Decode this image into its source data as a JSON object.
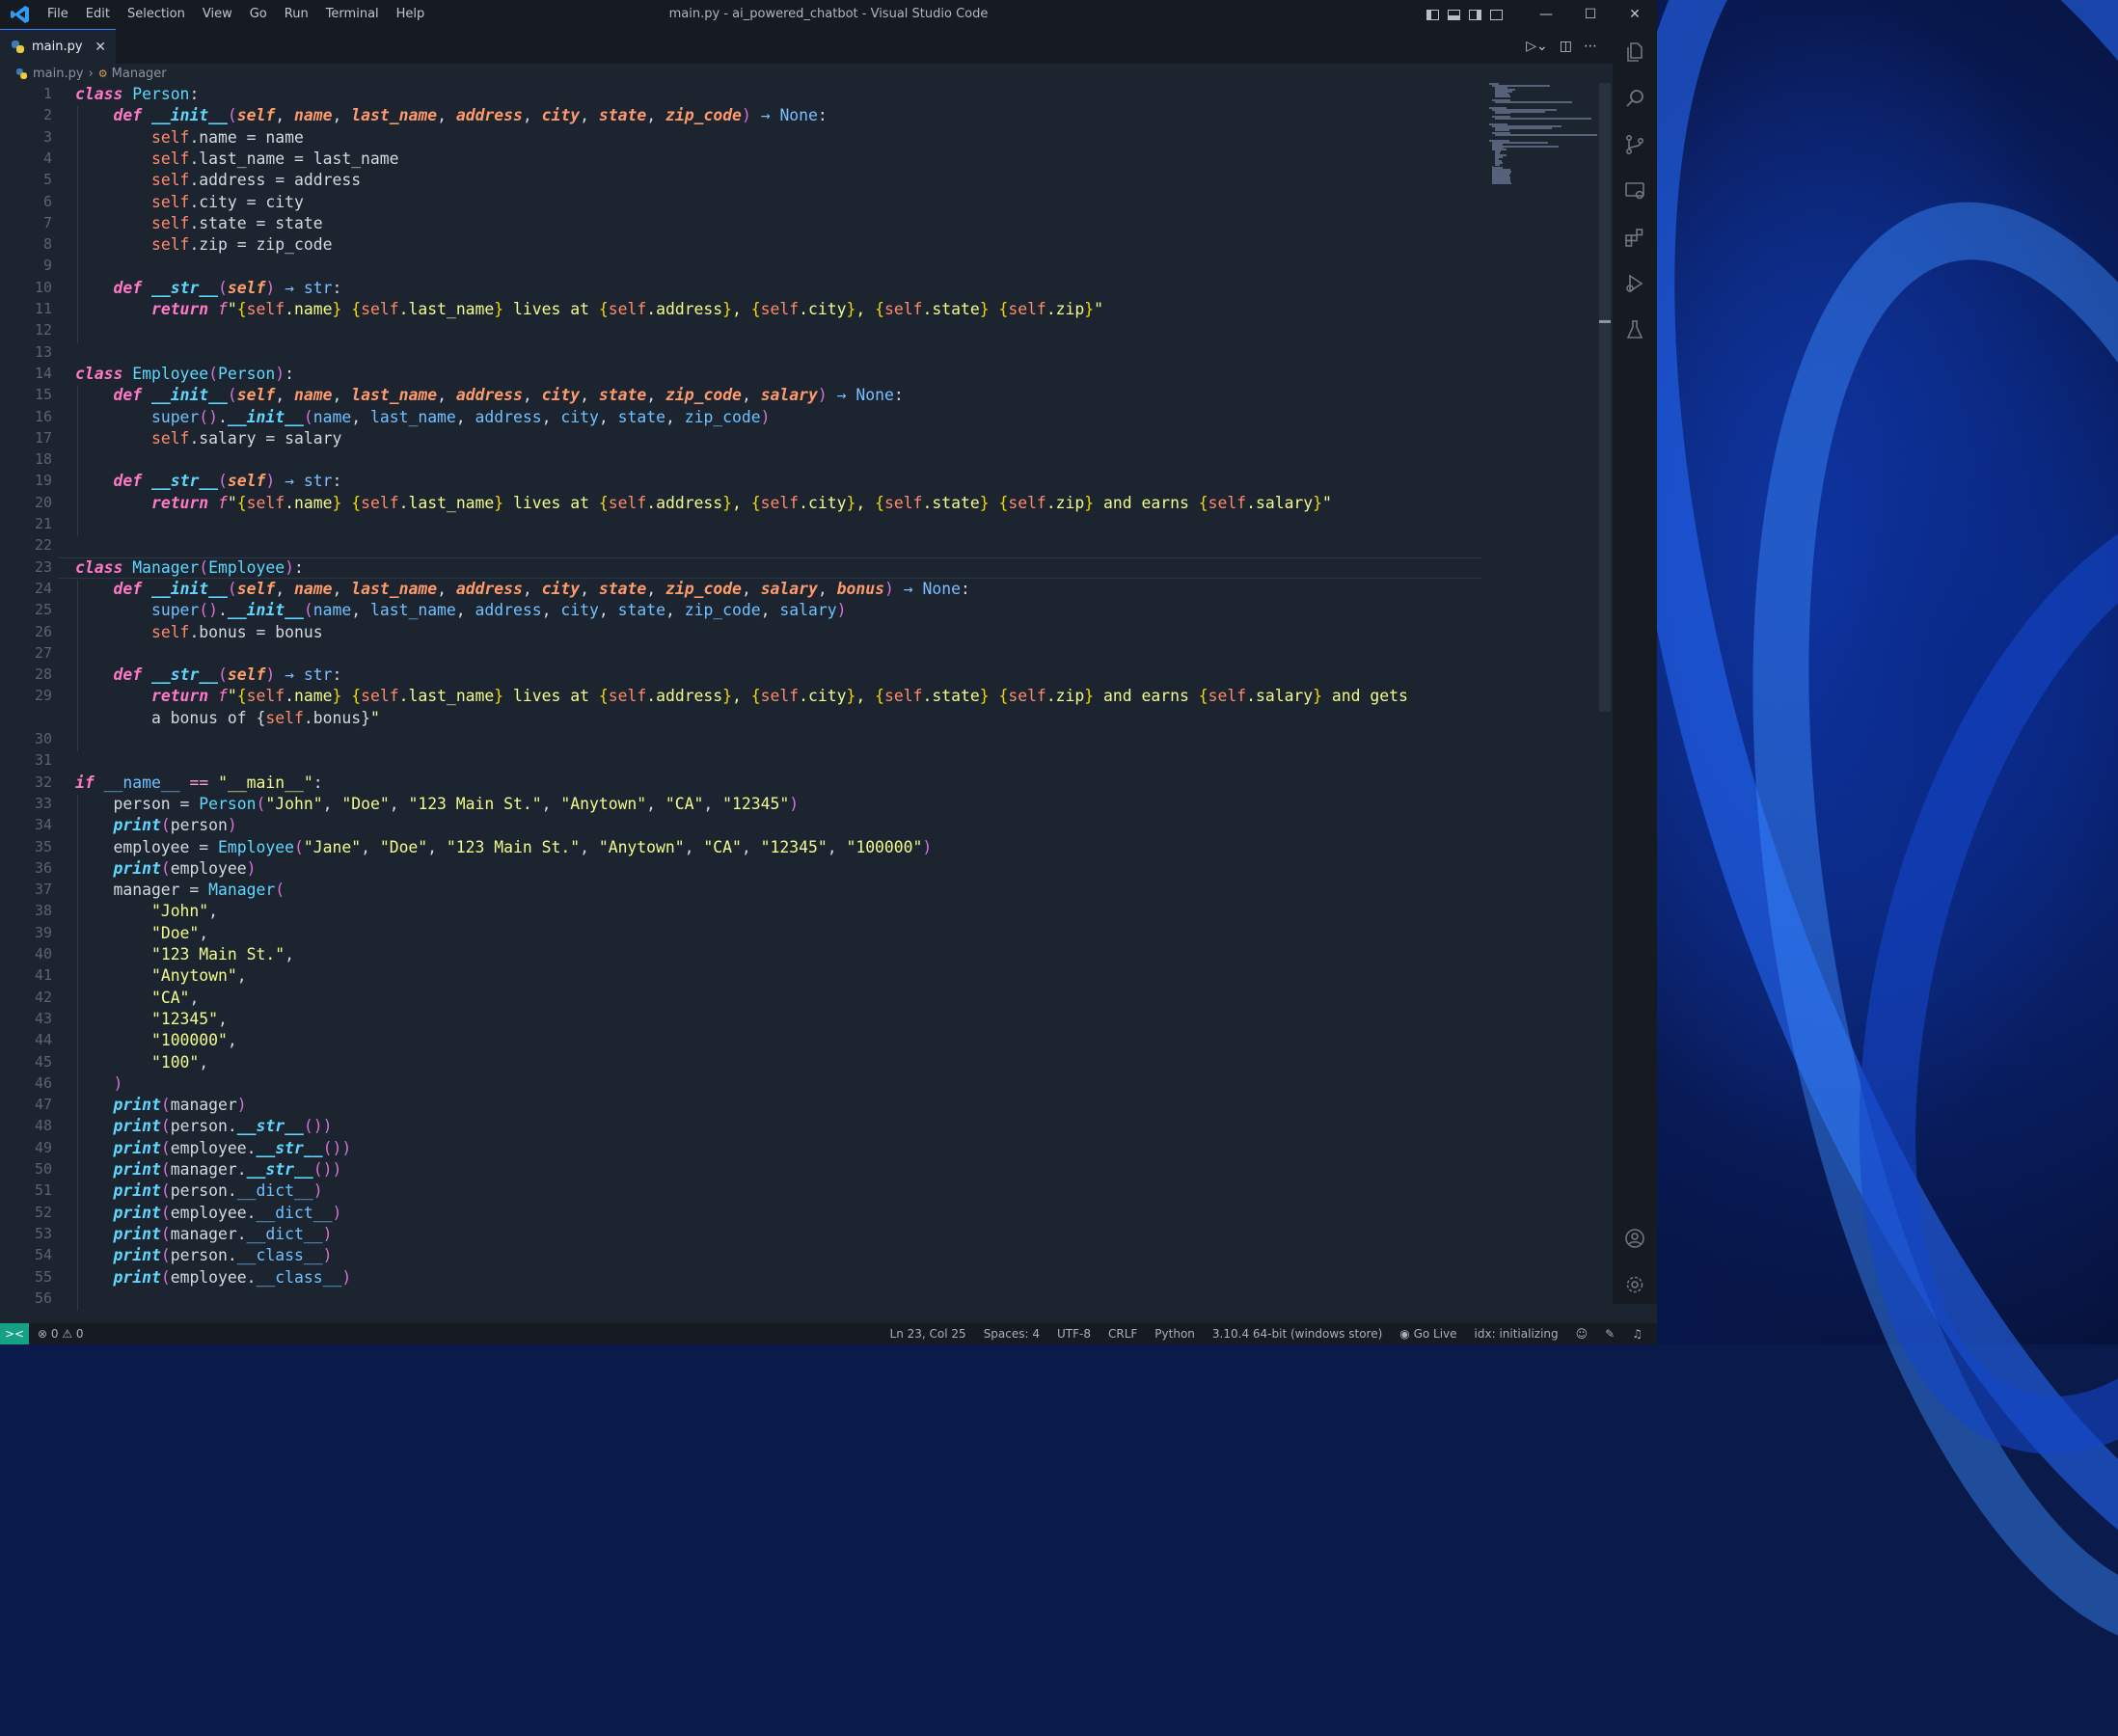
{
  "window": {
    "title": "main.py - ai_powered_chatbot - Visual Studio Code"
  },
  "menu": [
    "File",
    "Edit",
    "Selection",
    "View",
    "Go",
    "Run",
    "Terminal",
    "Help"
  ],
  "window_controls": {
    "minimize": "—",
    "maximize": "☐",
    "close": "✕"
  },
  "tab": {
    "label": "main.py",
    "close": "✕"
  },
  "breadcrumb": {
    "file": "main.py",
    "symbol": "Manager",
    "sep": "›"
  },
  "editor": {
    "current_line": 23,
    "lines": [
      "class Person:",
      "    def __init__(self, name, last_name, address, city, state, zip_code) → None:",
      "        self.name = name",
      "        self.last_name = last_name",
      "        self.address = address",
      "        self.city = city",
      "        self.state = state",
      "        self.zip = zip_code",
      "",
      "    def __str__(self) → str:",
      "        return f\"{self.name} {self.last_name} lives at {self.address}, {self.city}, {self.state} {self.zip}\"",
      "",
      "",
      "class Employee(Person):",
      "    def __init__(self, name, last_name, address, city, state, zip_code, salary) → None:",
      "        super().__init__(name, last_name, address, city, state, zip_code)",
      "        self.salary = salary",
      "",
      "    def __str__(self) → str:",
      "        return f\"{self.name} {self.last_name} lives at {self.address}, {self.city}, {self.state} {self.zip} and earns {self.salary}\"",
      "",
      "",
      "class Manager(Employee):",
      "    def __init__(self, name, last_name, address, city, state, zip_code, salary, bonus) → None:",
      "        super().__init__(name, last_name, address, city, state, zip_code, salary)",
      "        self.bonus = bonus",
      "",
      "    def __str__(self) → str:",
      "        return f\"{self.name} {self.last_name} lives at {self.address}, {self.city}, {self.state} {self.zip} and earns {self.salary} and gets",
      "",
      "",
      "if __name__ == \"__main__\":",
      "    person = Person(\"John\", \"Doe\", \"123 Main St.\", \"Anytown\", \"CA\", \"12345\")",
      "    print(person)",
      "    employee = Employee(\"Jane\", \"Doe\", \"123 Main St.\", \"Anytown\", \"CA\", \"12345\", \"100000\")",
      "    print(employee)",
      "    manager = Manager(",
      "        \"John\",",
      "        \"Doe\",",
      "        \"123 Main St.\",",
      "        \"Anytown\",",
      "        \"CA\",",
      "        \"12345\",",
      "        \"100000\",",
      "        \"100\",",
      "    )",
      "    print(manager)",
      "    print(person.__str__())",
      "    print(employee.__str__())",
      "    print(manager.__str__())",
      "    print(person.__dict__)",
      "    print(employee.__dict__)",
      "    print(manager.__dict__)",
      "    print(person.__class__)",
      "    print(employee.__class__)",
      ""
    ],
    "wrap_29": "        a bonus of {self.bonus}\""
  },
  "status": {
    "remote": "><",
    "problems": "⊗ 0 ⚠ 0",
    "position": "Ln 23, Col 25",
    "spaces": "Spaces: 4",
    "encoding": "UTF-8",
    "eol": "CRLF",
    "language": "Python",
    "interpreter": "3.10.4 64-bit (windows store)",
    "golive": "Go Live",
    "idx": "idx: initializing"
  }
}
